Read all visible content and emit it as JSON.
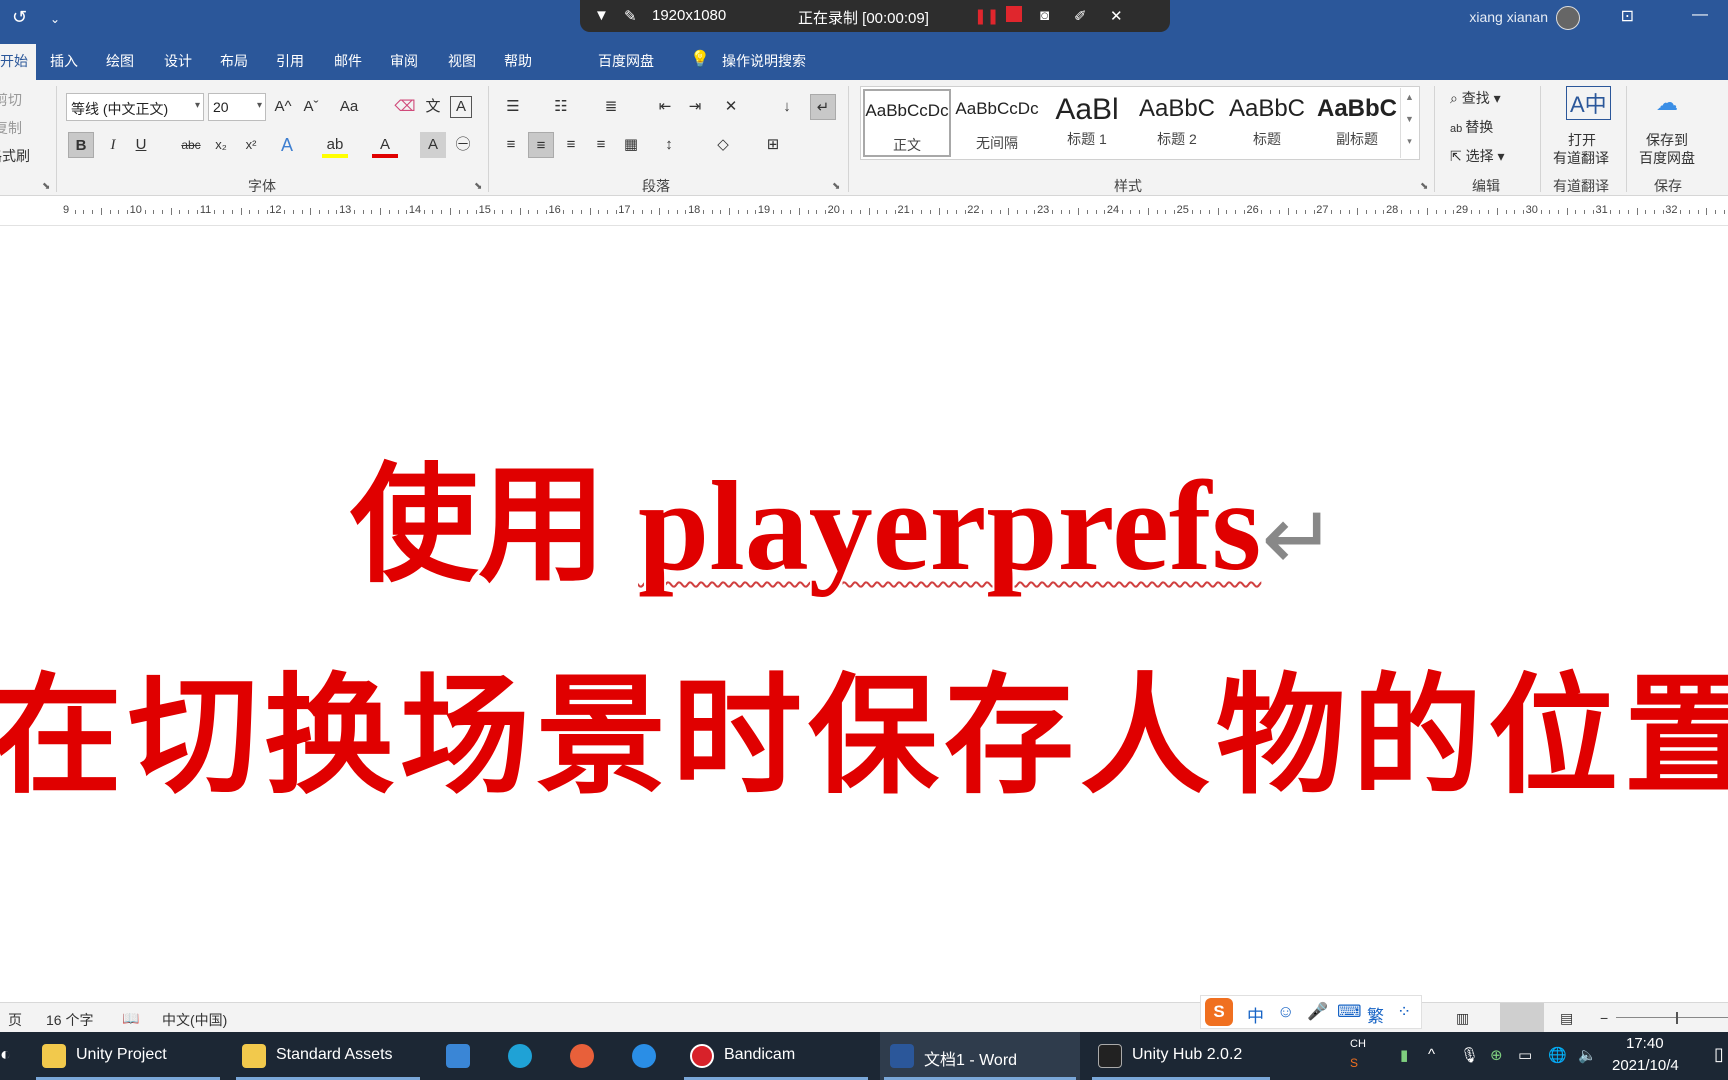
{
  "titlebar": {
    "undo_icon": "↺",
    "customize_icon": "⌄",
    "resolution": "1920x1080",
    "recording_status": "正在录制 [00:00:09]",
    "user_name": "xiang xianan",
    "ribbon_display_icon": "⊡",
    "minimize_icon": "—"
  },
  "tabs": [
    "开始",
    "插入",
    "绘图",
    "设计",
    "布局",
    "引用",
    "邮件",
    "审阅",
    "视图",
    "帮助",
    "百度网盘",
    "操作说明搜索"
  ],
  "clipboard": {
    "cut": "剪切",
    "copy": "复制",
    "format_painter": "格式刷"
  },
  "font": {
    "name": "等线 (中文正文)",
    "size": "20",
    "group_label": "字体",
    "grow": "A^",
    "shrink": "Aˇ",
    "case": "Aa",
    "bold": "B",
    "italic": "I",
    "underline": "U",
    "strike": "abc",
    "sub": "x₂",
    "sup": "x²"
  },
  "paragraph": {
    "group_label": "段落"
  },
  "styles": {
    "group_label": "样式",
    "items": [
      {
        "preview": "AaBbCcDc",
        "label": "正文"
      },
      {
        "preview": "AaBbCcDc",
        "label": "无间隔"
      },
      {
        "preview": "AaBl",
        "label": "标题 1"
      },
      {
        "preview": "AaBbC",
        "label": "标题 2"
      },
      {
        "preview": "AaBbC",
        "label": "标题"
      },
      {
        "preview": "AaBbC",
        "label": "副标题"
      }
    ]
  },
  "editing": {
    "find": "查找",
    "replace": "替换",
    "select": "选择",
    "group_label": "编辑"
  },
  "youdao": {
    "open": "打开",
    "translate": "有道翻译",
    "group_label": "有道翻译"
  },
  "baidu": {
    "save_line1": "保存到",
    "save_line2": "百度网盘",
    "group_label": "保存"
  },
  "ruler": {
    "ticks": [
      "9",
      "10",
      "11",
      "12",
      "13",
      "14",
      "15",
      "16",
      "17",
      "18",
      "19",
      "20",
      "21",
      "22",
      "23",
      "24",
      "25",
      "26",
      "27",
      "28",
      "29",
      "30",
      "31",
      "32"
    ]
  },
  "document": {
    "line1_cn": "使用 ",
    "line1_en": "playerprefs",
    "line2": "在切换场景时保存人物的位置",
    "para_mark": "↵"
  },
  "statusbar": {
    "page": "页",
    "word_count": "16 个字",
    "language": "中文(中国)"
  },
  "ime": {
    "logo": "S",
    "mode": "中",
    "items": [
      "☺",
      "🎤",
      "⌨",
      "繁",
      "⁘"
    ]
  },
  "taskbar": {
    "apps": [
      {
        "label": "Unity Project",
        "color": "#f2c94c"
      },
      {
        "label": "Standard Assets",
        "color": "#f2c94c"
      },
      {
        "label": "",
        "color": "#3a86d6"
      },
      {
        "label": "",
        "color": "#1fa2d6"
      },
      {
        "label": "",
        "color": "#e8603a"
      },
      {
        "label": "",
        "color": "#2a8ee6"
      },
      {
        "label": "Bandicam",
        "color": "#d8222a"
      },
      {
        "label": "文档1 - Word",
        "color": "#2b579a"
      },
      {
        "label": "Unity Hub 2.0.2",
        "color": "#222222"
      }
    ],
    "ime_indicator": "CH",
    "time": "17:40",
    "date": "2021/10/4"
  }
}
